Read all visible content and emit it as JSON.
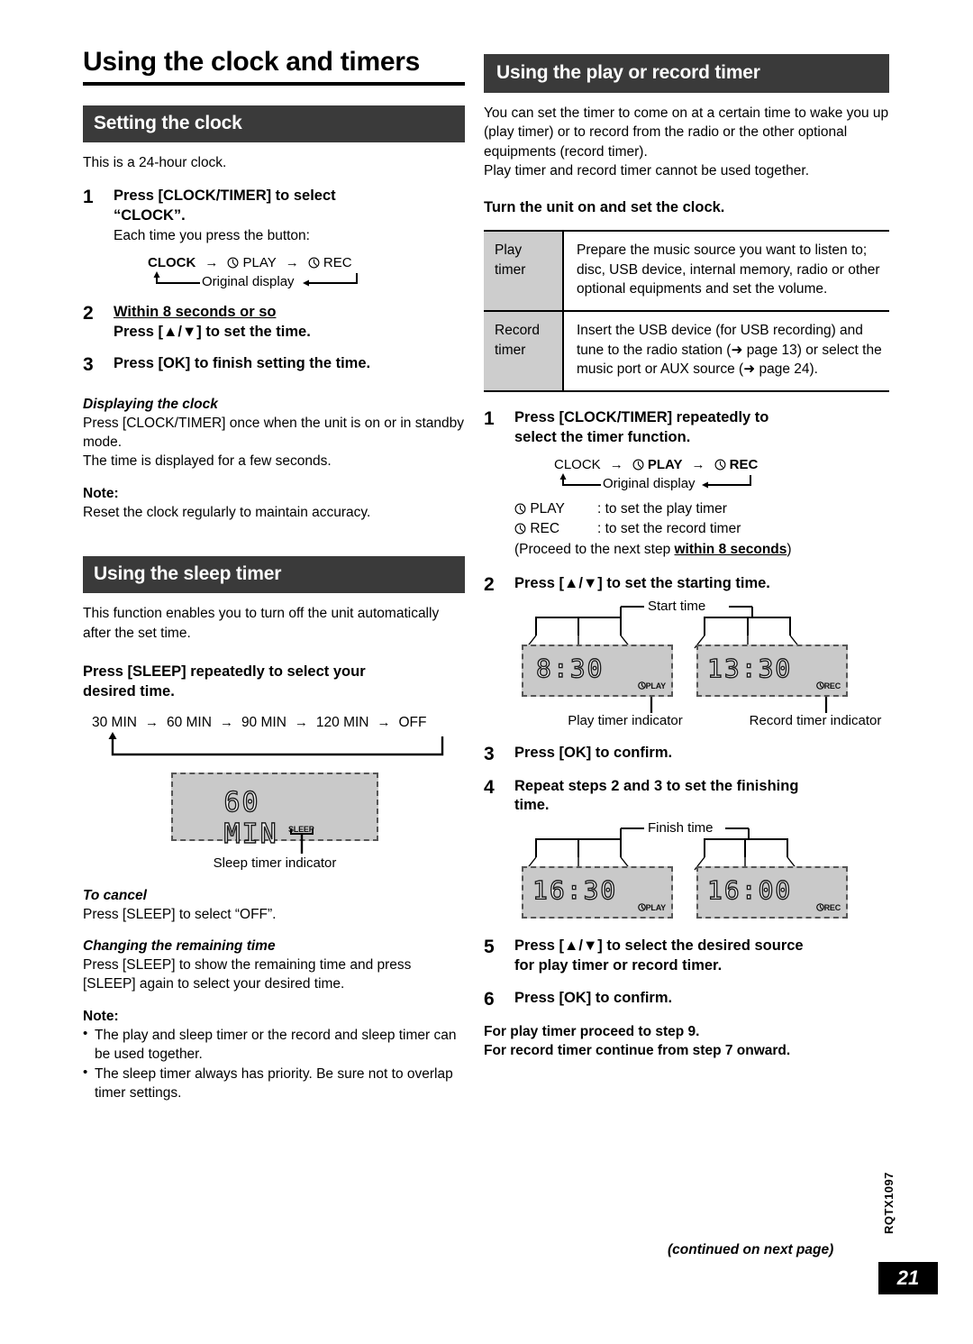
{
  "page": {
    "title": "Using the clock and timers",
    "number": "21",
    "doc_code": "RQTX1097",
    "continued": "(continued on next page)"
  },
  "left": {
    "setting_clock": {
      "heading": "Setting the clock",
      "intro": "This is a 24-hour clock.",
      "step1": {
        "num": "1",
        "title_line1": "Press [CLOCK/TIMER] to select",
        "title_line2": "“CLOCK”.",
        "sub": "Each time you press the button:"
      },
      "flow": {
        "item1": "CLOCK",
        "item2": "PLAY",
        "item3": "REC",
        "arrow": "→",
        "return_label": "Original display"
      },
      "step2": {
        "num": "2",
        "underline": "Within 8 seconds or so",
        "title": "Press [▲/▼] to set the time."
      },
      "step3": {
        "num": "3",
        "title": "Press [OK] to finish setting the time."
      },
      "displaying": {
        "heading": "Displaying the clock",
        "line1": "Press [CLOCK/TIMER] once when the unit is on or in standby mode.",
        "line2": "The time is displayed for a few seconds."
      },
      "note": {
        "heading": "Note:",
        "text": "Reset the clock regularly to maintain accuracy."
      }
    },
    "sleep_timer": {
      "heading": "Using the sleep timer",
      "intro": "This function enables you to turn off the unit automatically after the set time.",
      "press_line1": "Press [SLEEP] repeatedly to select your",
      "press_line2": "desired time.",
      "options": [
        "30 MIN",
        "60 MIN",
        "90 MIN",
        "120 MIN",
        "OFF"
      ],
      "arrow": "→",
      "lcd": {
        "value": "60 MIN",
        "indicator": "SLEEP",
        "caption": "Sleep timer indicator"
      },
      "to_cancel": {
        "heading": "To cancel",
        "text": "Press [SLEEP] to select “OFF”."
      },
      "changing": {
        "heading": "Changing the remaining time",
        "text": "Press [SLEEP] to show the remaining time and press [SLEEP] again to select your desired time."
      },
      "note": {
        "heading": "Note:",
        "bullet1": "The play and sleep timer or the record and sleep timer can be used together.",
        "bullet2": "The sleep timer always has priority. Be sure not to overlap timer settings."
      }
    }
  },
  "right": {
    "heading": "Using the play or record timer",
    "intro_line1": "You can set the timer to come on at a certain time to wake you up (play timer) or to record from the radio or the other optional equipments (record timer).",
    "intro_line2": "Play timer and record timer cannot be used together.",
    "turn_on": "Turn the unit on and set the clock.",
    "table": [
      {
        "label": "Play timer",
        "desc": "Prepare the music source you want to listen to; disc, USB device, internal memory, radio or other optional equipments and set the volume."
      },
      {
        "label": "Record timer",
        "desc": "Insert the USB device (for USB recording) and tune to the radio station (➜ page 13) or select the music port or AUX source (➜ page 24)."
      }
    ],
    "step1": {
      "num": "1",
      "title_line1": "Press [CLOCK/TIMER] repeatedly to",
      "title_line2": "select the timer function.",
      "flow": {
        "item1": "CLOCK",
        "item2": "PLAY",
        "item3": "REC",
        "arrow": "→",
        "return_label": "Original display"
      },
      "legend1_key": "PLAY",
      "legend1_val": ": to set the play timer",
      "legend2_key": "REC",
      "legend2_val": ": to set the record timer",
      "proceed_pre": "(Proceed to the next step ",
      "proceed_bold": "within 8 seconds",
      "proceed_post": ")"
    },
    "step2": {
      "num": "2",
      "title": "Press [▲/▼] to set the starting time.",
      "bracket_label": "Start time",
      "lcd_left": {
        "value": "8:30",
        "indicator": "PLAY",
        "caption": "Play timer indicator"
      },
      "lcd_right": {
        "value": "13:30",
        "indicator": "REC",
        "caption": "Record timer indicator"
      }
    },
    "step3": {
      "num": "3",
      "title": "Press [OK] to confirm."
    },
    "step4": {
      "num": "4",
      "title_line1": "Repeat steps 2 and 3 to set the finishing",
      "title_line2": "time.",
      "bracket_label": "Finish time",
      "lcd_left": {
        "value": "16:30",
        "indicator": "PLAY"
      },
      "lcd_right": {
        "value": "16:00",
        "indicator": "REC"
      }
    },
    "step5": {
      "num": "5",
      "title_line1": "Press [▲/▼] to select the desired source",
      "title_line2": "for play timer or record timer."
    },
    "step6": {
      "num": "6",
      "title": "Press [OK] to confirm."
    },
    "footer_note1": "For play timer proceed to step 9.",
    "footer_note2": "For record timer continue from step 7 onward."
  },
  "colors": {
    "bar": "#3a3a3a",
    "lcd_bg": "#c9c9c9",
    "table_label_bg": "#cdcdcd"
  }
}
